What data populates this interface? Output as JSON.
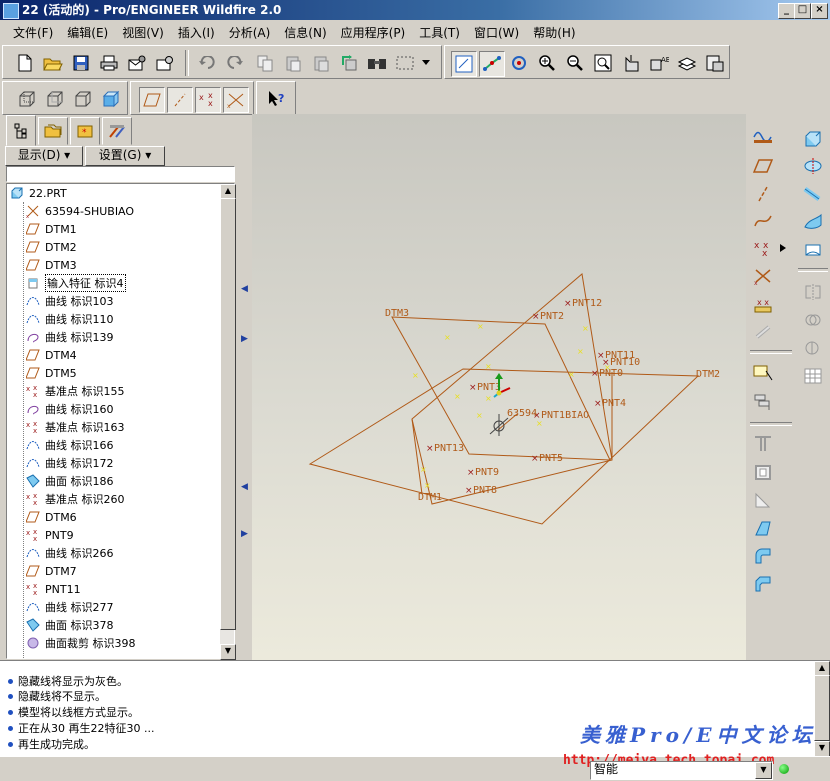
{
  "window": {
    "title": "22 (活动的) - Pro/ENGINEER Wildfire 2.0",
    "min": "_",
    "max": "□",
    "close": "×"
  },
  "menu": [
    "文件(F)",
    "编辑(E)",
    "视图(V)",
    "插入(I)",
    "分析(A)",
    "信息(N)",
    "应用程序(P)",
    "工具(T)",
    "窗口(W)",
    "帮助(H)"
  ],
  "panel": {
    "display_button": "显示(D) ▾",
    "settings_button": "设置(G) ▾"
  },
  "tree": {
    "root": "22.PRT",
    "items": [
      {
        "icon": "coord-sys-icon",
        "label": "63594-SHUBIAO"
      },
      {
        "icon": "datum-plane-icon",
        "label": "DTM1"
      },
      {
        "icon": "datum-plane-icon",
        "label": "DTM2"
      },
      {
        "icon": "datum-plane-icon",
        "label": "DTM3"
      },
      {
        "icon": "import-feature-icon",
        "label": "输入特征 标识4"
      },
      {
        "icon": "curve-icon",
        "label": "曲线 标识103"
      },
      {
        "icon": "curve-icon",
        "label": "曲线 标识110"
      },
      {
        "icon": "curve-purple-icon",
        "label": "曲线 标识139"
      },
      {
        "icon": "datum-plane-icon",
        "label": "DTM4"
      },
      {
        "icon": "datum-plane-icon",
        "label": "DTM5"
      },
      {
        "icon": "datum-point-icon",
        "label": "基准点 标识155"
      },
      {
        "icon": "curve-purple-icon",
        "label": "曲线 标识160"
      },
      {
        "icon": "datum-point-icon",
        "label": "基准点 标识163"
      },
      {
        "icon": "curve-icon",
        "label": "曲线 标识166"
      },
      {
        "icon": "curve-icon",
        "label": "曲线 标识172"
      },
      {
        "icon": "surface-icon",
        "label": "曲面 标识186"
      },
      {
        "icon": "datum-point-icon",
        "label": "基准点 标识260"
      },
      {
        "icon": "datum-plane-icon",
        "label": "DTM6"
      },
      {
        "icon": "datum-point-icon",
        "label": "PNT9"
      },
      {
        "icon": "curve-icon",
        "label": "曲线 标识266"
      },
      {
        "icon": "datum-plane-icon",
        "label": "DTM7"
      },
      {
        "icon": "datum-point-icon",
        "label": "PNT11"
      },
      {
        "icon": "curve-icon",
        "label": "曲线 标识277"
      },
      {
        "icon": "surface-icon",
        "label": "曲面 标识378"
      },
      {
        "icon": "surface-trim-icon",
        "label": "曲面裁剪 标识398"
      }
    ]
  },
  "model": {
    "planes": [
      "DTM1",
      "DTM2",
      "DTM3"
    ],
    "points": [
      {
        "label": "PNT12"
      },
      {
        "label": "PNT2"
      },
      {
        "label": "PNT11"
      },
      {
        "label": "PNT10"
      },
      {
        "label": "PNT0"
      },
      {
        "label": "PNT4"
      },
      {
        "label": "PNT3"
      },
      {
        "label": "PNT1BIAO"
      },
      {
        "label": "PNT13"
      },
      {
        "label": "PNT5"
      },
      {
        "label": "PNT9"
      },
      {
        "label": "PNT8"
      }
    ],
    "csys_label": "63594",
    "line_color": "#b05a18",
    "point_color": "#9a1818",
    "yellow_color": "#e8e020"
  },
  "messages": [
    "隐藏线将显示为灰色。",
    "隐藏线将不显示。",
    "模型将以线框方式显示。",
    "正在从30 再生22特征30 ...",
    "再生成功完成。"
  ],
  "watermark": "美雅Pro/E中文论坛",
  "status": {
    "url": "http://meiya.tech.topaj.com",
    "filter": "智能"
  }
}
